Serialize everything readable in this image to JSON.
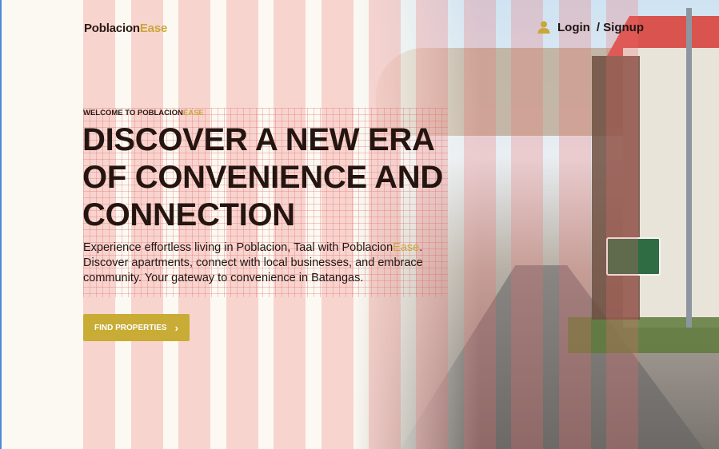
{
  "header": {
    "logo_main": "Poblacion",
    "logo_accent": "Ease",
    "login_label": "Login",
    "signup_label": "/ Signup",
    "user_icon": "user-icon"
  },
  "hero": {
    "eyebrow_main": "WELCOME TO POBLACION",
    "eyebrow_accent": "EASE",
    "headline_lines": [
      "DISCOVER A NEW ERA",
      "OF CONVENIENCE AND",
      "CONNECTION"
    ],
    "lead_before": "Experience effortless living in Poblacion, Taal with Poblacion",
    "lead_accent": "Ease",
    "lead_after": ". Discover apartments, connect with local businesses, and embrace community. Your gateway to convenience in Batangas.",
    "cta_label": "FIND PROPERTIES",
    "cta_icon": "chevron-right-icon"
  },
  "colors": {
    "accent": "#c9a73a",
    "button": "#c8ac35",
    "text": "#251510",
    "background": "#fbf9f2",
    "stripe_overlay": "#f06e6e"
  }
}
